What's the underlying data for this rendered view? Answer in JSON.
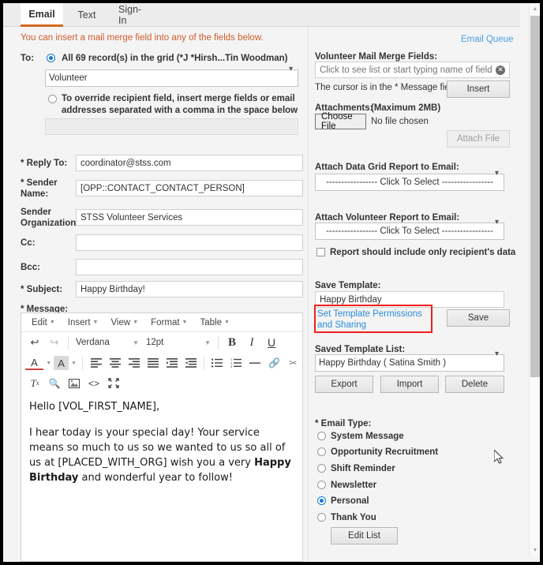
{
  "tabs": [
    {
      "label": "Email",
      "active": true
    },
    {
      "label": "Text",
      "active": false
    },
    {
      "label": "Sign-In",
      "active": false
    }
  ],
  "notice": "You can insert a mail merge field into any of the fields below.",
  "left": {
    "to_label": "To:",
    "radio_all_label": "All 69 record(s) in the grid (*J *Hirsh...Tin Woodman)",
    "recipient_select_value": "Volunteer",
    "radio_override_line1": "To override recipient field, insert merge fields or email",
    "radio_override_line2": "addresses separated with a comma in the space below",
    "override_value": "",
    "fields": [
      {
        "label": "* Reply To:",
        "value": "coordinator@stss.com"
      },
      {
        "label": "* Sender Name:",
        "value": "[OPP::CONTACT_CONTACT_PERSON]"
      },
      {
        "label": "Sender Organization:",
        "value": "STSS Volunteer Services"
      },
      {
        "label": "Cc:",
        "value": ""
      },
      {
        "label": "Bcc:",
        "value": ""
      },
      {
        "label": "* Subject:",
        "value": "Happy Birthday!"
      }
    ],
    "message_label": "* Message:"
  },
  "editor": {
    "menus": [
      "Edit",
      "Insert",
      "View",
      "Format",
      "Table"
    ],
    "font_family": "Verdana",
    "font_size": "12pt",
    "body": {
      "greeting": "Hello [VOL_FIRST_NAME],",
      "para_part1": "I hear today is your special day! Your service means so much to us so we wanted to us so all of us at [PLACED_WITH_ORG] wish you a very ",
      "para_bold": "Happy Birthday",
      "para_part2": " and wonderful year to follow!"
    }
  },
  "right": {
    "email_queue_link": "Email Queue",
    "merge_fields_label": "Volunteer Mail Merge Fields:",
    "merge_fields_placeholder": "Click to see list or start typing name of field",
    "merge_fields_value": "",
    "cursor_hint": "The cursor is in the * Message field.",
    "insert_button": "Insert",
    "attachments_label": "Attachments:",
    "attachments_max": "(Maximum 2MB)",
    "choose_file_button": "Choose File",
    "no_file_text": "No file chosen",
    "attach_file_button": "Attach File",
    "attach_grid_label": "Attach Data Grid Report to Email:",
    "attach_grid_value": "----------------- Click To Select -----------------",
    "attach_vol_label": "Attach Volunteer Report to Email:",
    "attach_vol_value": "----------------- Click To Select -----------------",
    "report_only_recipient_label": "Report should include only recipient's data",
    "report_only_recipient_checked": false,
    "save_template_label": "Save Template:",
    "save_template_value": "Happy Birthday",
    "permissions_link_line1": "Set Template Permissions and",
    "permissions_link_line2": "Sharing",
    "save_button": "Save",
    "saved_list_label": "Saved Template List:",
    "saved_list_value": "Happy Birthday ( Satina Smith )",
    "export_button": "Export",
    "import_button": "Import",
    "delete_button": "Delete",
    "email_type_label": "* Email Type:",
    "email_types": [
      {
        "label": "System Message",
        "selected": false
      },
      {
        "label": "Opportunity Recruitment",
        "selected": false
      },
      {
        "label": "Shift Reminder",
        "selected": false
      },
      {
        "label": "Newsletter",
        "selected": false
      },
      {
        "label": "Personal",
        "selected": true
      },
      {
        "label": "Thank You",
        "selected": false
      }
    ],
    "edit_list_button": "Edit List"
  },
  "colors": {
    "accent_orange": "#d2691e",
    "notice_orange": "#cf5c2c",
    "link_blue": "#4a9fe0",
    "radio_blue": "#1976d2",
    "highlight_red": "#f01e1e"
  }
}
